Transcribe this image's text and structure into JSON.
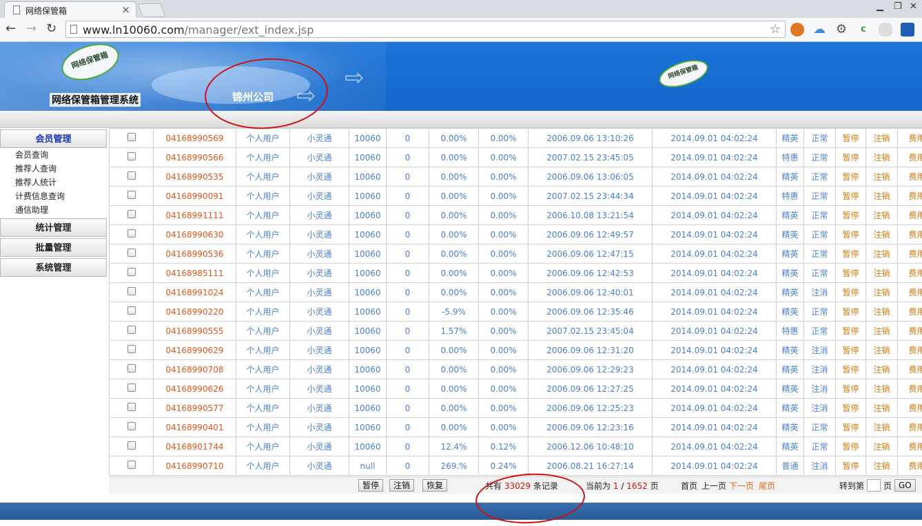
{
  "browser": {
    "tab_title": "网络保管箱",
    "close_glyph": "×",
    "url_host": "www.ln10060.com",
    "url_path": "/manager/ext_index.jsp"
  },
  "banner": {
    "logo_text": "网络保管箱",
    "system_title": "网络保管箱管理系统",
    "company": "锦州公司"
  },
  "sidebar": {
    "sections": [
      {
        "label": "会员管理",
        "items": [
          "会员查询",
          "推荐人查询",
          "推荐人统计",
          "计费信息查询",
          "通信助理"
        ]
      },
      {
        "label": "统计管理"
      },
      {
        "label": "批量管理"
      },
      {
        "label": "系统管理"
      }
    ]
  },
  "table": {
    "rows": [
      {
        "num": "04168990569",
        "type": "个人用户",
        "net": "小灵通",
        "code": "10060",
        "zero": "0",
        "p1": "0.00%",
        "p2": "0.00%",
        "t1": "2006.09.06 13:10:26",
        "t2": "2014.09.01 04:02:24",
        "plan": "精英",
        "status": "正常"
      },
      {
        "num": "04168990566",
        "type": "个人用户",
        "net": "小灵通",
        "code": "10060",
        "zero": "0",
        "p1": "0.00%",
        "p2": "0.00%",
        "t1": "2007.02.15 23:45:05",
        "t2": "2014.09.01 04:02:24",
        "plan": "特惠",
        "status": "正常"
      },
      {
        "num": "04168990535",
        "type": "个人用户",
        "net": "小灵通",
        "code": "10060",
        "zero": "0",
        "p1": "0.00%",
        "p2": "0.00%",
        "t1": "2006.09.06 13:06:05",
        "t2": "2014.09.01 04:02:24",
        "plan": "精英",
        "status": "正常"
      },
      {
        "num": "04168990091",
        "type": "个人用户",
        "net": "小灵通",
        "code": "10060",
        "zero": "0",
        "p1": "0.00%",
        "p2": "0.00%",
        "t1": "2007.02.15 23:44:34",
        "t2": "2014.09.01 04:02:24",
        "plan": "特惠",
        "status": "正常"
      },
      {
        "num": "04168991111",
        "type": "个人用户",
        "net": "小灵通",
        "code": "10060",
        "zero": "0",
        "p1": "0.00%",
        "p2": "0.00%",
        "t1": "2006.10.08 13:21:54",
        "t2": "2014.09.01 04:02:24",
        "plan": "精英",
        "status": "正常"
      },
      {
        "num": "04168990630",
        "type": "个人用户",
        "net": "小灵通",
        "code": "10060",
        "zero": "0",
        "p1": "0.00%",
        "p2": "0.00%",
        "t1": "2006.09.06 12:49:57",
        "t2": "2014.09.01 04:02:24",
        "plan": "精英",
        "status": "正常"
      },
      {
        "num": "04168990536",
        "type": "个人用户",
        "net": "小灵通",
        "code": "10060",
        "zero": "0",
        "p1": "0.00%",
        "p2": "0.00%",
        "t1": "2006.09.06 12:47:15",
        "t2": "2014.09.01 04:02:24",
        "plan": "精英",
        "status": "正常"
      },
      {
        "num": "04168985111",
        "type": "个人用户",
        "net": "小灵通",
        "code": "10060",
        "zero": "0",
        "p1": "0.00%",
        "p2": "0.00%",
        "t1": "2006.09.06 12:42:53",
        "t2": "2014.09.01 04:02:24",
        "plan": "精英",
        "status": "正常"
      },
      {
        "num": "04168991024",
        "type": "个人用户",
        "net": "小灵通",
        "code": "10060",
        "zero": "0",
        "p1": "0.00%",
        "p2": "0.00%",
        "t1": "2006.09.06 12:40:01",
        "t2": "2014.09.01 04:02:24",
        "plan": "精英",
        "status": "注消"
      },
      {
        "num": "04168990220",
        "type": "个人用户",
        "net": "小灵通",
        "code": "10060",
        "zero": "0",
        "p1": "-5.9%",
        "p2": "0.00%",
        "t1": "2006.09.06 12:35:46",
        "t2": "2014.09.01 04:02:24",
        "plan": "精英",
        "status": "正常"
      },
      {
        "num": "04168990555",
        "type": "个人用户",
        "net": "小灵通",
        "code": "10060",
        "zero": "0",
        "p1": "1.57%",
        "p2": "0.00%",
        "t1": "2007.02.15 23:45:04",
        "t2": "2014.09.01 04:02:24",
        "plan": "特惠",
        "status": "正常"
      },
      {
        "num": "04168990629",
        "type": "个人用户",
        "net": "小灵通",
        "code": "10060",
        "zero": "0",
        "p1": "0.00%",
        "p2": "0.00%",
        "t1": "2006.09.06 12:31:20",
        "t2": "2014.09.01 04:02:24",
        "plan": "精英",
        "status": "注消"
      },
      {
        "num": "04168990708",
        "type": "个人用户",
        "net": "小灵通",
        "code": "10060",
        "zero": "0",
        "p1": "0.00%",
        "p2": "0.00%",
        "t1": "2006.09.06 12:29:23",
        "t2": "2014.09.01 04:02:24",
        "plan": "精英",
        "status": "注消"
      },
      {
        "num": "04168990626",
        "type": "个人用户",
        "net": "小灵通",
        "code": "10060",
        "zero": "0",
        "p1": "0.00%",
        "p2": "0.00%",
        "t1": "2006.09.06 12:27:25",
        "t2": "2014.09.01 04:02:24",
        "plan": "精英",
        "status": "注消"
      },
      {
        "num": "04168990577",
        "type": "个人用户",
        "net": "小灵通",
        "code": "10060",
        "zero": "0",
        "p1": "0.00%",
        "p2": "0.00%",
        "t1": "2006.09.06 12:25:23",
        "t2": "2014.09.01 04:02:24",
        "plan": "精英",
        "status": "注消"
      },
      {
        "num": "04168990401",
        "type": "个人用户",
        "net": "小灵通",
        "code": "10060",
        "zero": "0",
        "p1": "0.00%",
        "p2": "0.00%",
        "t1": "2006.09.06 12:23:16",
        "t2": "2014.09.01 04:02:24",
        "plan": "精英",
        "status": "正常"
      },
      {
        "num": "04168901744",
        "type": "个人用户",
        "net": "小灵通",
        "code": "10060",
        "zero": "0",
        "p1": "12.4%",
        "p2": "0.12%",
        "t1": "2006.12.06 10:48:10",
        "t2": "2014.09.01 04:02:24",
        "plan": "精英",
        "status": "正常"
      },
      {
        "num": "04168990710",
        "type": "个人用户",
        "net": "小灵通",
        "code": "null",
        "zero": "0",
        "p1": "269.%",
        "p2": "0.24%",
        "t1": "2006.08.21 16:27:14",
        "t2": "2014.09.01 04:02:24",
        "plan": "普通",
        "status": "注消"
      }
    ],
    "action_pause": "暂停",
    "action_cancel": "注销",
    "action_fee": "费用"
  },
  "bottom": {
    "btn_pause": "暂停",
    "btn_cancel": "注销",
    "btn_restore": "恢复",
    "total_prefix": "共有",
    "total_count": "33029",
    "total_suffix": "条记录",
    "current_prefix": "当前为",
    "current_page": "1",
    "page_sep": "/",
    "page_total": "1652",
    "page_unit": "页",
    "first_page": "首页",
    "prev_page": "上一页",
    "next_page": "下一页",
    "last_page": "尾页",
    "goto_label": "转到第",
    "goto_unit": "页",
    "go_button": "GO"
  }
}
